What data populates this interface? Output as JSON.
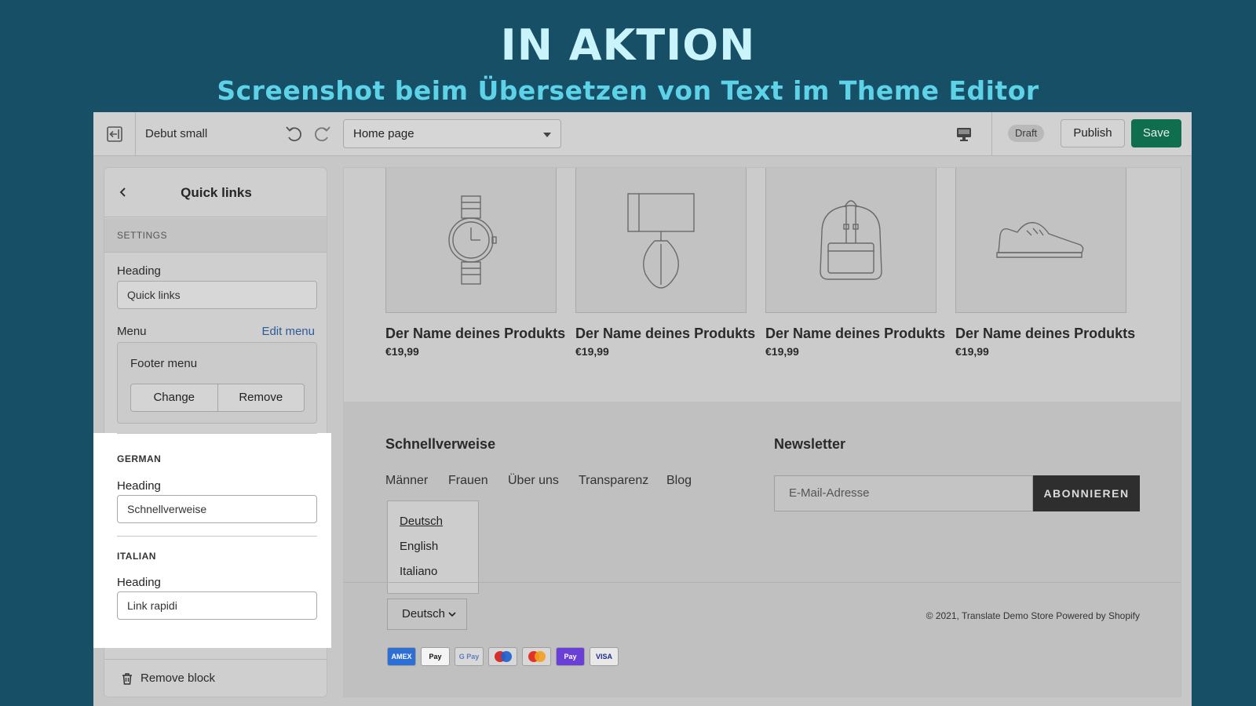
{
  "banner": {
    "title": "IN AKTION",
    "subtitle": "Screenshot beim Übersetzen von Text im Theme Editor"
  },
  "topbar": {
    "theme_name": "Debut small",
    "page_select": "Home page",
    "draft_badge": "Draft",
    "publish_label": "Publish",
    "save_label": "Save"
  },
  "sidebar": {
    "title": "Quick links",
    "section_label": "SETTINGS",
    "heading_label": "Heading",
    "heading_value": "Quick links",
    "menu_label": "Menu",
    "edit_menu": "Edit menu",
    "menu_name": "Footer menu",
    "change_label": "Change",
    "remove_label": "Remove",
    "german": {
      "label": "GERMAN",
      "field_label": "Heading",
      "value": "Schnellverweise"
    },
    "italian": {
      "label": "ITALIAN",
      "field_label": "Heading",
      "value": "Link rapidi"
    },
    "remove_block": "Remove block"
  },
  "preview": {
    "products": [
      {
        "name": "Der Name deines Produkts",
        "price": "€19,99",
        "icon": "watch-icon"
      },
      {
        "name": "Der Name deines Produkts",
        "price": "€19,99",
        "icon": "lamp-icon"
      },
      {
        "name": "Der Name deines Produkts",
        "price": "€19,99",
        "icon": "backpack-icon"
      },
      {
        "name": "Der Name deines Produkts",
        "price": "€19,99",
        "icon": "sneaker-icon"
      }
    ],
    "footer": {
      "quicklinks_heading": "Schnellverweise",
      "links": [
        "Männer",
        "Frauen",
        "Über uns",
        "Transparenz",
        "Blog"
      ],
      "newsletter_heading": "Newsletter",
      "email_placeholder": "E-Mail-Adresse",
      "subscribe_label": "ABONNIEREN",
      "language_options": [
        "Deutsch",
        "English",
        "Italiano"
      ],
      "language_selected": "Deutsch",
      "copyright": "© 2021, Translate Demo Store",
      "powered_by": "Powered by Shopify",
      "payment_methods": [
        "AMEX",
        "Pay",
        "G Pay",
        "maestro",
        "mastercard",
        "Pay",
        "VISA"
      ]
    }
  },
  "colors": {
    "banner_bg": "#174f66",
    "banner_title": "#c9f4fb",
    "banner_subtitle": "#5ed3e8",
    "save_button": "#0f6e4d"
  }
}
